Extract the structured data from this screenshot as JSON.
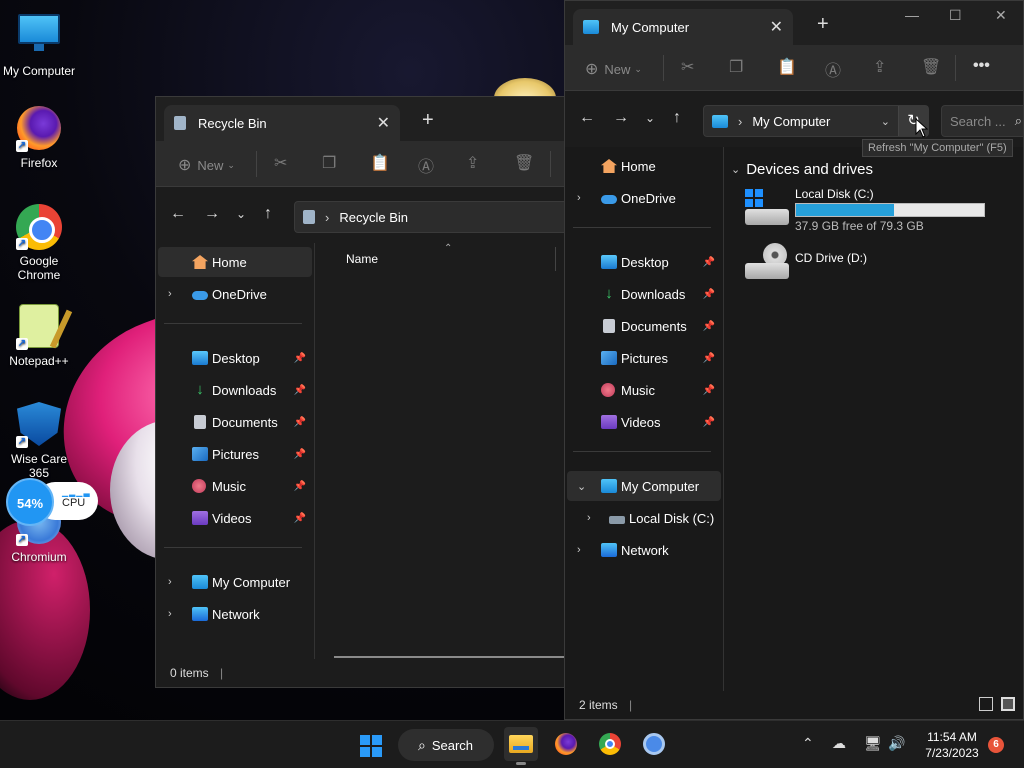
{
  "desktop": {
    "icons": [
      {
        "label": "My Computer"
      },
      {
        "label": "Firefox"
      },
      {
        "label": "Google Chrome"
      },
      {
        "label": "Notepad++"
      },
      {
        "label": "Wise Care 365"
      },
      {
        "label": "Chromium"
      }
    ],
    "cpu_widget": {
      "percent": "54%",
      "label": "CPU"
    }
  },
  "recycle_window": {
    "tab_title": "Recycle Bin",
    "toolbar": {
      "new_label": "New"
    },
    "address": "Recycle Bin",
    "column_name": "Name",
    "sidebar": {
      "home": "Home",
      "onedrive": "OneDrive",
      "desktop": "Desktop",
      "downloads": "Downloads",
      "documents": "Documents",
      "pictures": "Pictures",
      "music": "Music",
      "videos": "Videos",
      "my_computer": "My Computer",
      "network": "Network"
    },
    "status": "0 items"
  },
  "computer_window": {
    "tab_title": "My Computer",
    "toolbar": {
      "new_label": "New"
    },
    "address": "My Computer",
    "search_placeholder": "Search ...",
    "refresh_tooltip": "Refresh \"My Computer\" (F5)",
    "sidebar": {
      "home": "Home",
      "onedrive": "OneDrive",
      "desktop": "Desktop",
      "downloads": "Downloads",
      "documents": "Documents",
      "pictures": "Pictures",
      "music": "Music",
      "videos": "Videos",
      "my_computer": "My Computer",
      "local_disk": "Local Disk (C:)",
      "network": "Network"
    },
    "section_title": "Devices and drives",
    "drives": [
      {
        "name": "Local Disk (C:)",
        "free": "37.9 GB free of 79.3 GB",
        "used_fraction": 0.52
      },
      {
        "name": "CD Drive (D:)"
      }
    ],
    "status": "2 items"
  },
  "taskbar": {
    "search_label": "Search",
    "time": "11:54 AM",
    "date": "7/23/2023",
    "notification_count": "6"
  }
}
